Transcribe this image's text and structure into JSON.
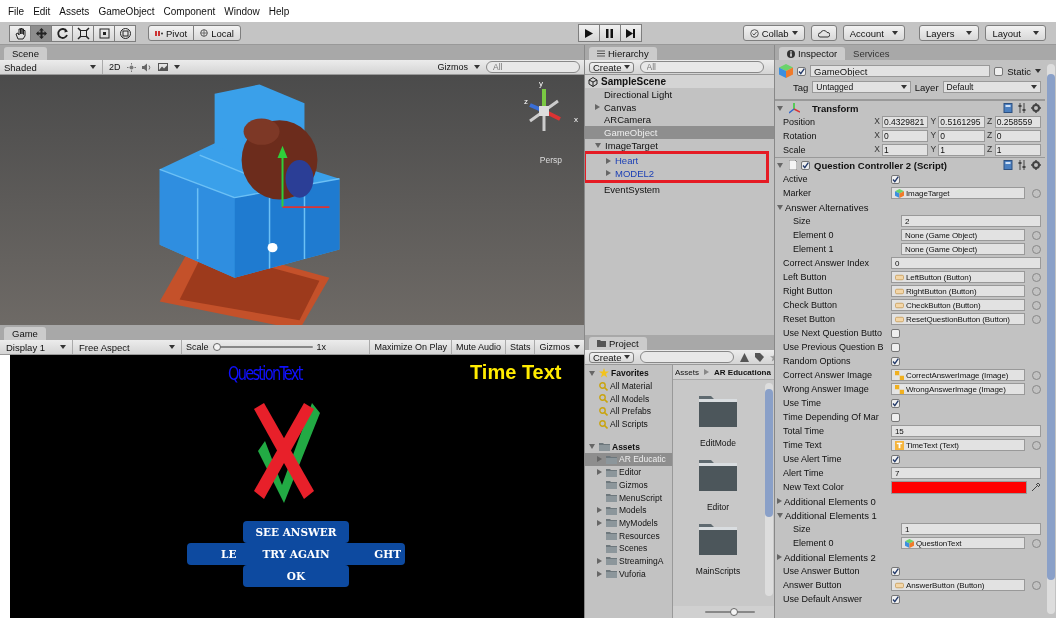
{
  "menu": [
    "File",
    "Edit",
    "Assets",
    "GameObject",
    "Component",
    "Window",
    "Help"
  ],
  "toolbar": {
    "tools": [
      {
        "kind": "hand",
        "selected": false
      },
      {
        "kind": "move",
        "selected": true
      },
      {
        "kind": "rotate",
        "selected": false
      },
      {
        "kind": "scale",
        "selected": false
      },
      {
        "kind": "rect",
        "selected": false
      },
      {
        "kind": "transform",
        "selected": false
      }
    ],
    "pivot": "Pivot",
    "local": "Local",
    "playback": [
      {
        "kind": "play",
        "selected": false
      },
      {
        "kind": "pause",
        "selected": false
      },
      {
        "kind": "step",
        "selected": false
      }
    ],
    "collab": "Collab",
    "account": "Account",
    "layers": "Layers",
    "layout": "Layout"
  },
  "scene": {
    "tab": "Scene",
    "shading": "Shaded",
    "mode_2d": "2D",
    "gizmos": "Gizmos",
    "search_placeholder": "All",
    "persp": "Persp",
    "axes": [
      "y",
      "x",
      "z"
    ]
  },
  "game": {
    "tab": "Game",
    "display": "Display 1",
    "aspect": "Free Aspect",
    "scale_label": "Scale",
    "scale": {
      "level": 0
    },
    "scale_value": "1x",
    "options": [
      "Maximize On Play",
      "Mute Audio",
      "Stats",
      "Gizmos"
    ],
    "question_text": "QuestionText",
    "time_text": "Time Text",
    "buttons": {
      "top": "SEE ANSWER",
      "left": "LE",
      "center": "TRY AGAIN",
      "right": "GHT",
      "bottom": "OK"
    }
  },
  "hierarchy": {
    "tab": "Hierarchy",
    "create": "Create",
    "search_placeholder": "All",
    "scene": "SampleScene",
    "items": [
      {
        "label": "Directional Light",
        "kind": "leaf",
        "prefab": false,
        "selected": false
      },
      {
        "label": "Canvas",
        "kind": "parent",
        "expanded": false,
        "prefab": false,
        "selected": false
      },
      {
        "label": "ARCamera",
        "kind": "leaf",
        "prefab": false,
        "selected": false
      },
      {
        "label": "GameObject",
        "kind": "leaf",
        "prefab": false,
        "selected": true
      },
      {
        "label": "ImageTarget",
        "kind": "parent",
        "expanded": true,
        "prefab": false,
        "selected": false,
        "children_marked": true,
        "children": [
          {
            "label": "Heart",
            "kind": "parent",
            "expanded": false,
            "prefab": true,
            "selected": false
          },
          {
            "label": "MODEL2",
            "kind": "parent",
            "expanded": false,
            "prefab": true,
            "selected": false
          }
        ]
      },
      {
        "label": "EventSystem",
        "kind": "leaf",
        "prefab": false,
        "selected": false
      }
    ]
  },
  "project": {
    "tab": "Project",
    "create": "Create",
    "favorites_label": "Favorites",
    "favorites": [
      "All Material",
      "All Models",
      "All Prefabs",
      "All Scripts"
    ],
    "assets_label": "Assets",
    "folders": [
      {
        "label": "AR Educatic",
        "kind": "parent",
        "expanded": false,
        "selected": true
      },
      {
        "label": "Editor",
        "kind": "parent",
        "expanded": false,
        "selected": false
      },
      {
        "label": "Gizmos",
        "kind": "leaf",
        "selected": false
      },
      {
        "label": "MenuScript",
        "kind": "leaf",
        "selected": false
      },
      {
        "label": "Models",
        "kind": "parent",
        "expanded": false,
        "selected": false
      },
      {
        "label": "MyModels",
        "kind": "parent",
        "expanded": false,
        "selected": false
      },
      {
        "label": "Resources",
        "kind": "leaf",
        "selected": false
      },
      {
        "label": "Scenes",
        "kind": "leaf",
        "selected": false
      },
      {
        "label": "StreamingA",
        "kind": "parent",
        "expanded": false,
        "selected": false
      },
      {
        "label": "Vuforia",
        "kind": "parent",
        "expanded": false,
        "selected": false
      }
    ],
    "breadcrumb": [
      "Assets",
      "AR Educationa"
    ],
    "grid": [
      "EditMode",
      "Editor",
      "MainScripts"
    ],
    "zoom": {
      "level": 0.57
    }
  },
  "inspector": {
    "tabs": [
      {
        "label": "Inspector",
        "selected": true
      },
      {
        "label": "Services",
        "selected": false
      }
    ],
    "object": {
      "active": true,
      "name": "GameObject",
      "static": false,
      "static_label": "Static",
      "tag_label": "Tag",
      "tag": "Untagged",
      "layer_label": "Layer",
      "layer": "Default"
    },
    "transform": {
      "title": "Transform",
      "rows": [
        {
          "label": "Position",
          "values": [
            {
              "axis": "X",
              "value": "0.4329821"
            },
            {
              "axis": "Y",
              "value": "0.5161295"
            },
            {
              "axis": "Z",
              "value": "0.258559"
            }
          ]
        },
        {
          "label": "Rotation",
          "values": [
            {
              "axis": "X",
              "value": "0"
            },
            {
              "axis": "Y",
              "value": "0"
            },
            {
              "axis": "Z",
              "value": "0"
            }
          ]
        },
        {
          "label": "Scale",
          "values": [
            {
              "axis": "X",
              "value": "1"
            },
            {
              "axis": "Y",
              "value": "1"
            },
            {
              "axis": "Z",
              "value": "1"
            }
          ]
        }
      ]
    },
    "component": {
      "title": "Question Controller 2 (Script)",
      "enabled": true,
      "fields": [
        {
          "kind": "check",
          "label": "Active",
          "checked": true
        },
        {
          "kind": "gameobject_ref",
          "label": "Marker",
          "value": "ImageTarget"
        },
        {
          "kind": "foldout",
          "label": "Answer Alternatives",
          "expanded": true,
          "children": [
            {
              "kind": "text",
              "label": "Size",
              "value": "2"
            },
            {
              "kind": "empty_ref",
              "label": "Element 0",
              "value": "None (Game Object)"
            },
            {
              "kind": "empty_ref",
              "label": "Element 1",
              "value": "None (Game Object)"
            }
          ]
        },
        {
          "kind": "text",
          "label": "Correct Answer Index",
          "value": "0"
        },
        {
          "kind": "button_ref",
          "label": "Left Button",
          "value": "LeftButton (Button)"
        },
        {
          "kind": "button_ref",
          "label": "Right Button",
          "value": "RightButton (Button)"
        },
        {
          "kind": "button_ref",
          "label": "Check Button",
          "value": "CheckButton (Button)"
        },
        {
          "kind": "button_ref",
          "label": "Reset Button",
          "value": "ResetQuestionButton (Button)"
        },
        {
          "kind": "check",
          "label": "Use Next Question Butto",
          "checked": false
        },
        {
          "kind": "check",
          "label": "Use Previous Question B",
          "checked": false
        },
        {
          "kind": "check",
          "label": "Random Options",
          "checked": true
        },
        {
          "kind": "image_ref",
          "label": "Correct Answer Image",
          "value": "CorrectAnswerImage (Image)"
        },
        {
          "kind": "image_ref",
          "label": "Wrong Answer Image",
          "value": "WrongAnswerImage (Image)"
        },
        {
          "kind": "check",
          "label": "Use Time",
          "checked": true
        },
        {
          "kind": "check",
          "label": "Time Depending Of Mar",
          "checked": false
        },
        {
          "kind": "text",
          "label": "Total Time",
          "value": "15"
        },
        {
          "kind": "text_ref",
          "label": "Time Text",
          "value": "TimeText (Text)"
        },
        {
          "kind": "check",
          "label": "Use Alert Time",
          "checked": true
        },
        {
          "kind": "text",
          "label": "Alert Time",
          "value": "7"
        },
        {
          "kind": "color",
          "label": "New Text Color",
          "color": "#ff0000"
        },
        {
          "kind": "foldout",
          "label": "Additional Elements 0",
          "expanded": false
        },
        {
          "kind": "foldout",
          "label": "Additional Elements 1",
          "expanded": true,
          "children": [
            {
              "kind": "text",
              "label": "Size",
              "value": "1"
            },
            {
              "kind": "gameobject_ref",
              "label": "Element 0",
              "value": "QuestionText"
            }
          ]
        },
        {
          "kind": "foldout",
          "label": "Additional Elements 2",
          "expanded": false
        },
        {
          "kind": "check",
          "label": "Use Answer Button",
          "checked": true
        },
        {
          "kind": "button_ref",
          "label": "Answer Button",
          "value": "AnswerButton (Button)"
        },
        {
          "kind": "check",
          "label": "Use Default Answer",
          "checked": true
        }
      ]
    }
  }
}
